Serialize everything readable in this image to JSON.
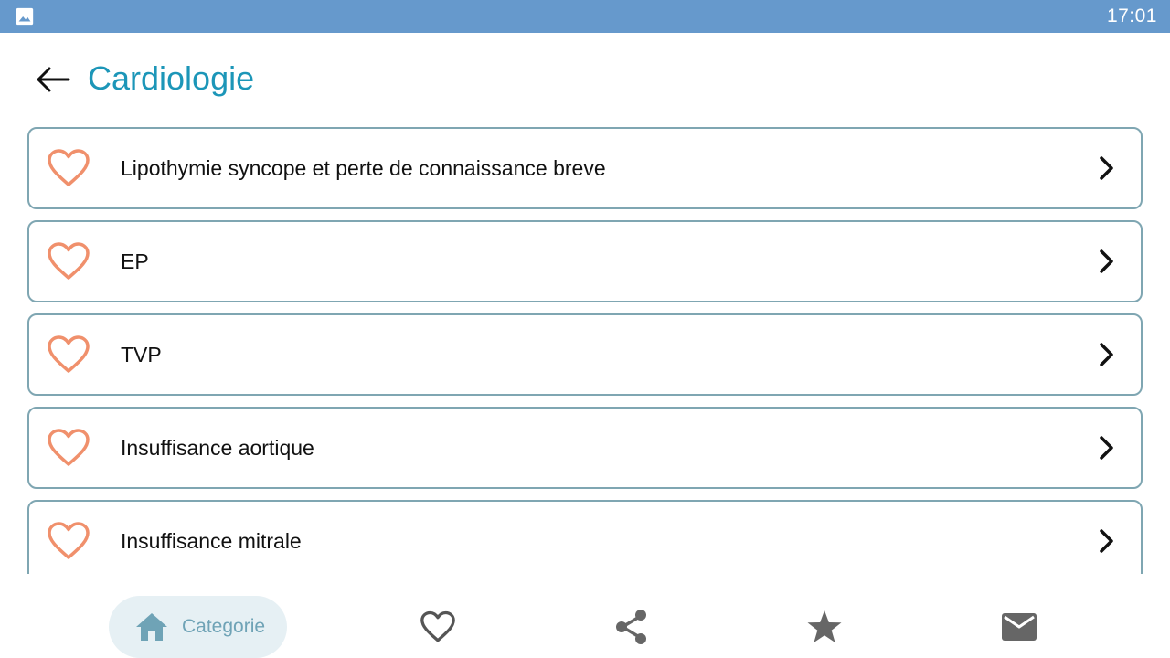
{
  "status_bar": {
    "time": "17:01",
    "left_icon": "image-icon"
  },
  "header": {
    "title": "Cardiologie",
    "back_icon": "arrow-left-icon"
  },
  "list": {
    "items": [
      {
        "label": "Lipothymie syncope et perte de connaissance breve"
      },
      {
        "label": "EP"
      },
      {
        "label": "TVP"
      },
      {
        "label": "Insuffisance aortique"
      },
      {
        "label": "Insuffisance mitrale"
      }
    ],
    "item_icons": {
      "favorite": "heart-outline-icon",
      "open": "chevron-right-icon"
    }
  },
  "bottom_nav": {
    "items": [
      {
        "id": "categorie",
        "label": "Categorie",
        "icon": "home-icon",
        "active": true
      },
      {
        "id": "favorites",
        "icon": "heart-outline-icon"
      },
      {
        "id": "share",
        "icon": "share-icon"
      },
      {
        "id": "rate",
        "icon": "star-icon"
      },
      {
        "id": "contact",
        "icon": "mail-icon"
      }
    ]
  },
  "colors": {
    "status_bar": "#6699cc",
    "title": "#1c96b8",
    "card_border": "#7fa6b2",
    "heart": "#f0906c",
    "nav_active_bg": "#e6f0f4",
    "nav_active_fg": "#6fa3b6",
    "nav_icon": "#666666"
  }
}
